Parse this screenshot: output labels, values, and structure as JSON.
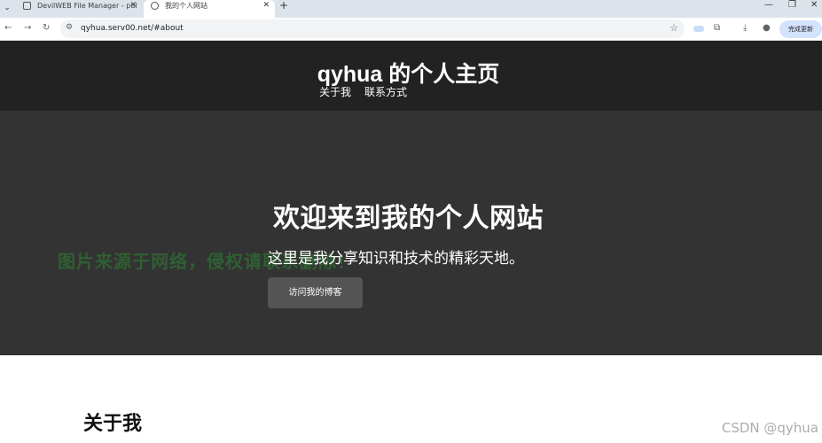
{
  "browser": {
    "tabs": [
      {
        "label": "DevilWEB File Manager - pul",
        "close": "✕"
      },
      {
        "label": "我的个人网站",
        "close": "✕"
      }
    ],
    "tab_menu": "⌄",
    "new_tab": "+",
    "window_controls": {
      "minimize": "—",
      "restore": "❐",
      "close": "✕"
    },
    "back": "←",
    "forward": "→",
    "reload": "↻",
    "url": "qyhua.serv00.net/#about",
    "site_info": "⚙",
    "star": "☆",
    "extensions": "⧉",
    "download": "⤓",
    "profile": "●",
    "update_label": "完成更新",
    "update_more": "⋮"
  },
  "site": {
    "title": "qyhua 的个人主页",
    "nav": [
      "关于我",
      "联系方式"
    ]
  },
  "hero": {
    "title": "欢迎来到我的个人网站",
    "subtitle": "这里是我分享知识和技术的精彩天地。",
    "button_label": "访问我的博客",
    "watermark": "图片来源于网络，侵权请联系删除！"
  },
  "about": {
    "title": "关于我"
  },
  "footer_watermark": "CSDN @qyhua",
  "colors": {
    "header_bg": "#222222",
    "hero_bg": "#333333",
    "button_bg": "#555555",
    "watermark_green": "#2e7d32"
  }
}
